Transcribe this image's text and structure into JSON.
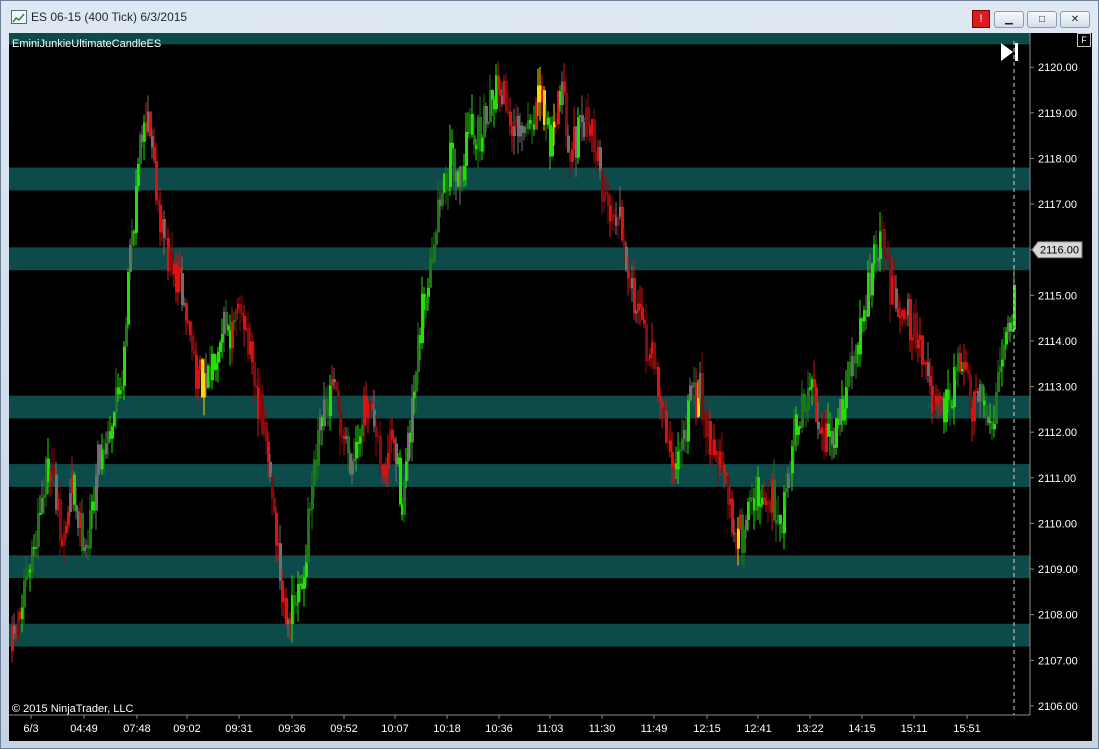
{
  "window": {
    "title": "ES 06-15 (400 Tick)  6/3/2015",
    "alert_label": "!",
    "minimize_label": "▁",
    "maximize_label": "□",
    "close_label": "✕",
    "f_label": "F"
  },
  "chart_data": {
    "type": "candlestick",
    "instrument": "ES 06-15",
    "indicator_label": "EminiJunkieUltimateCandleES",
    "copyright": "© 2015 NinjaTrader, LLC",
    "last_price_label": "2116.00",
    "ylim": [
      2105.8,
      2120.75
    ],
    "y_ticks": [
      "2106.00",
      "2107.00",
      "2108.00",
      "2109.00",
      "2110.00",
      "2111.00",
      "2112.00",
      "2113.00",
      "2114.00",
      "2115.00",
      "2116.00",
      "2117.00",
      "2118.00",
      "2119.00",
      "2120.00"
    ],
    "x_ticks": [
      "6/3",
      "04:49",
      "07:48",
      "09:02",
      "09:31",
      "09:36",
      "09:52",
      "10:07",
      "10:18",
      "10:36",
      "11:03",
      "11:30",
      "11:49",
      "12:15",
      "12:41",
      "13:22",
      "14:15",
      "15:11",
      "15:51"
    ],
    "zones": [
      [
        2120.5,
        2120.95
      ],
      [
        2117.3,
        2117.8
      ],
      [
        2115.55,
        2116.05
      ],
      [
        2112.3,
        2112.8
      ],
      [
        2110.8,
        2111.3
      ],
      [
        2108.8,
        2109.3
      ],
      [
        2107.3,
        2107.8
      ]
    ],
    "colors": {
      "background": "#000000",
      "zone": "#0d4a4a",
      "bright_green": "#22e000",
      "dark_green": "#1a7a10",
      "red": "#e01010",
      "dark_red": "#8a0a0a",
      "yellow": "#ffd400",
      "gray": "#6f6f6f",
      "text": "#ffffff",
      "price_box": "#d8d8d8"
    },
    "price_path": [
      [
        0,
        2107.2
      ],
      [
        8,
        2107.8
      ],
      [
        18,
        2108.7
      ],
      [
        30,
        2110.4
      ],
      [
        40,
        2111.5
      ],
      [
        52,
        2109.4
      ],
      [
        62,
        2110.8
      ],
      [
        70,
        2109.9
      ],
      [
        78,
        2109.6
      ],
      [
        88,
        2111.4
      ],
      [
        98,
        2112.0
      ],
      [
        112,
        2113.3
      ],
      [
        120,
        2116.0
      ],
      [
        126,
        2117.2
      ],
      [
        134,
        2119.1
      ],
      [
        140,
        2118.7
      ],
      [
        150,
        2116.7
      ],
      [
        160,
        2115.6
      ],
      [
        170,
        2115.2
      ],
      [
        178,
        2114.3
      ],
      [
        186,
        2113.4
      ],
      [
        196,
        2112.8
      ],
      [
        204,
        2113.8
      ],
      [
        214,
        2114.6
      ],
      [
        222,
        2114.1
      ],
      [
        232,
        2114.9
      ],
      [
        242,
        2113.2
      ],
      [
        252,
        2112.2
      ],
      [
        262,
        2110.7
      ],
      [
        272,
        2108.4
      ],
      [
        282,
        2108.0
      ],
      [
        292,
        2108.7
      ],
      [
        302,
        2110.7
      ],
      [
        312,
        2112.2
      ],
      [
        322,
        2112.9
      ],
      [
        332,
        2112.0
      ],
      [
        342,
        2111.4
      ],
      [
        352,
        2112.5
      ],
      [
        362,
        2112.2
      ],
      [
        372,
        2111.0
      ],
      [
        382,
        2111.9
      ],
      [
        392,
        2110.5
      ],
      [
        402,
        2112.3
      ],
      [
        412,
        2114.6
      ],
      [
        420,
        2115.8
      ],
      [
        430,
        2117.1
      ],
      [
        440,
        2117.9
      ],
      [
        450,
        2117.6
      ],
      [
        460,
        2118.8
      ],
      [
        470,
        2118.4
      ],
      [
        480,
        2119.4
      ],
      [
        490,
        2119.7
      ],
      [
        500,
        2118.9
      ],
      [
        510,
        2118.3
      ],
      [
        520,
        2118.8
      ],
      [
        530,
        2119.3
      ],
      [
        540,
        2118.4
      ],
      [
        550,
        2119.6
      ],
      [
        560,
        2118.3
      ],
      [
        570,
        2118.5
      ],
      [
        580,
        2118.9
      ],
      [
        590,
        2117.6
      ],
      [
        600,
        2116.8
      ],
      [
        610,
        2116.9
      ],
      [
        620,
        2115.4
      ],
      [
        630,
        2114.3
      ],
      [
        640,
        2113.7
      ],
      [
        650,
        2112.9
      ],
      [
        660,
        2111.3
      ],
      [
        670,
        2111.6
      ],
      [
        680,
        2112.6
      ],
      [
        690,
        2112.9
      ],
      [
        700,
        2111.9
      ],
      [
        712,
        2111.2
      ],
      [
        722,
        2110.0
      ],
      [
        732,
        2109.7
      ],
      [
        742,
        2110.8
      ],
      [
        752,
        2110.3
      ],
      [
        762,
        2110.6
      ],
      [
        772,
        2110.1
      ],
      [
        782,
        2111.9
      ],
      [
        792,
        2112.4
      ],
      [
        802,
        2113.0
      ],
      [
        812,
        2112.1
      ],
      [
        822,
        2111.6
      ],
      [
        832,
        2112.7
      ],
      [
        842,
        2113.5
      ],
      [
        852,
        2114.3
      ],
      [
        862,
        2115.6
      ],
      [
        872,
        2116.2
      ],
      [
        882,
        2115.0
      ],
      [
        892,
        2114.9
      ],
      [
        902,
        2114.3
      ],
      [
        912,
        2113.9
      ],
      [
        922,
        2112.5
      ],
      [
        932,
        2112.3
      ],
      [
        942,
        2112.9
      ],
      [
        952,
        2113.6
      ],
      [
        962,
        2112.4
      ],
      [
        972,
        2112.7
      ],
      [
        982,
        2112.2
      ],
      [
        992,
        2114.0
      ],
      [
        1000,
        2114.3
      ],
      [
        1006,
        2115.3
      ],
      [
        1014,
        2116.2
      ],
      [
        1020,
        2116.0
      ]
    ]
  }
}
